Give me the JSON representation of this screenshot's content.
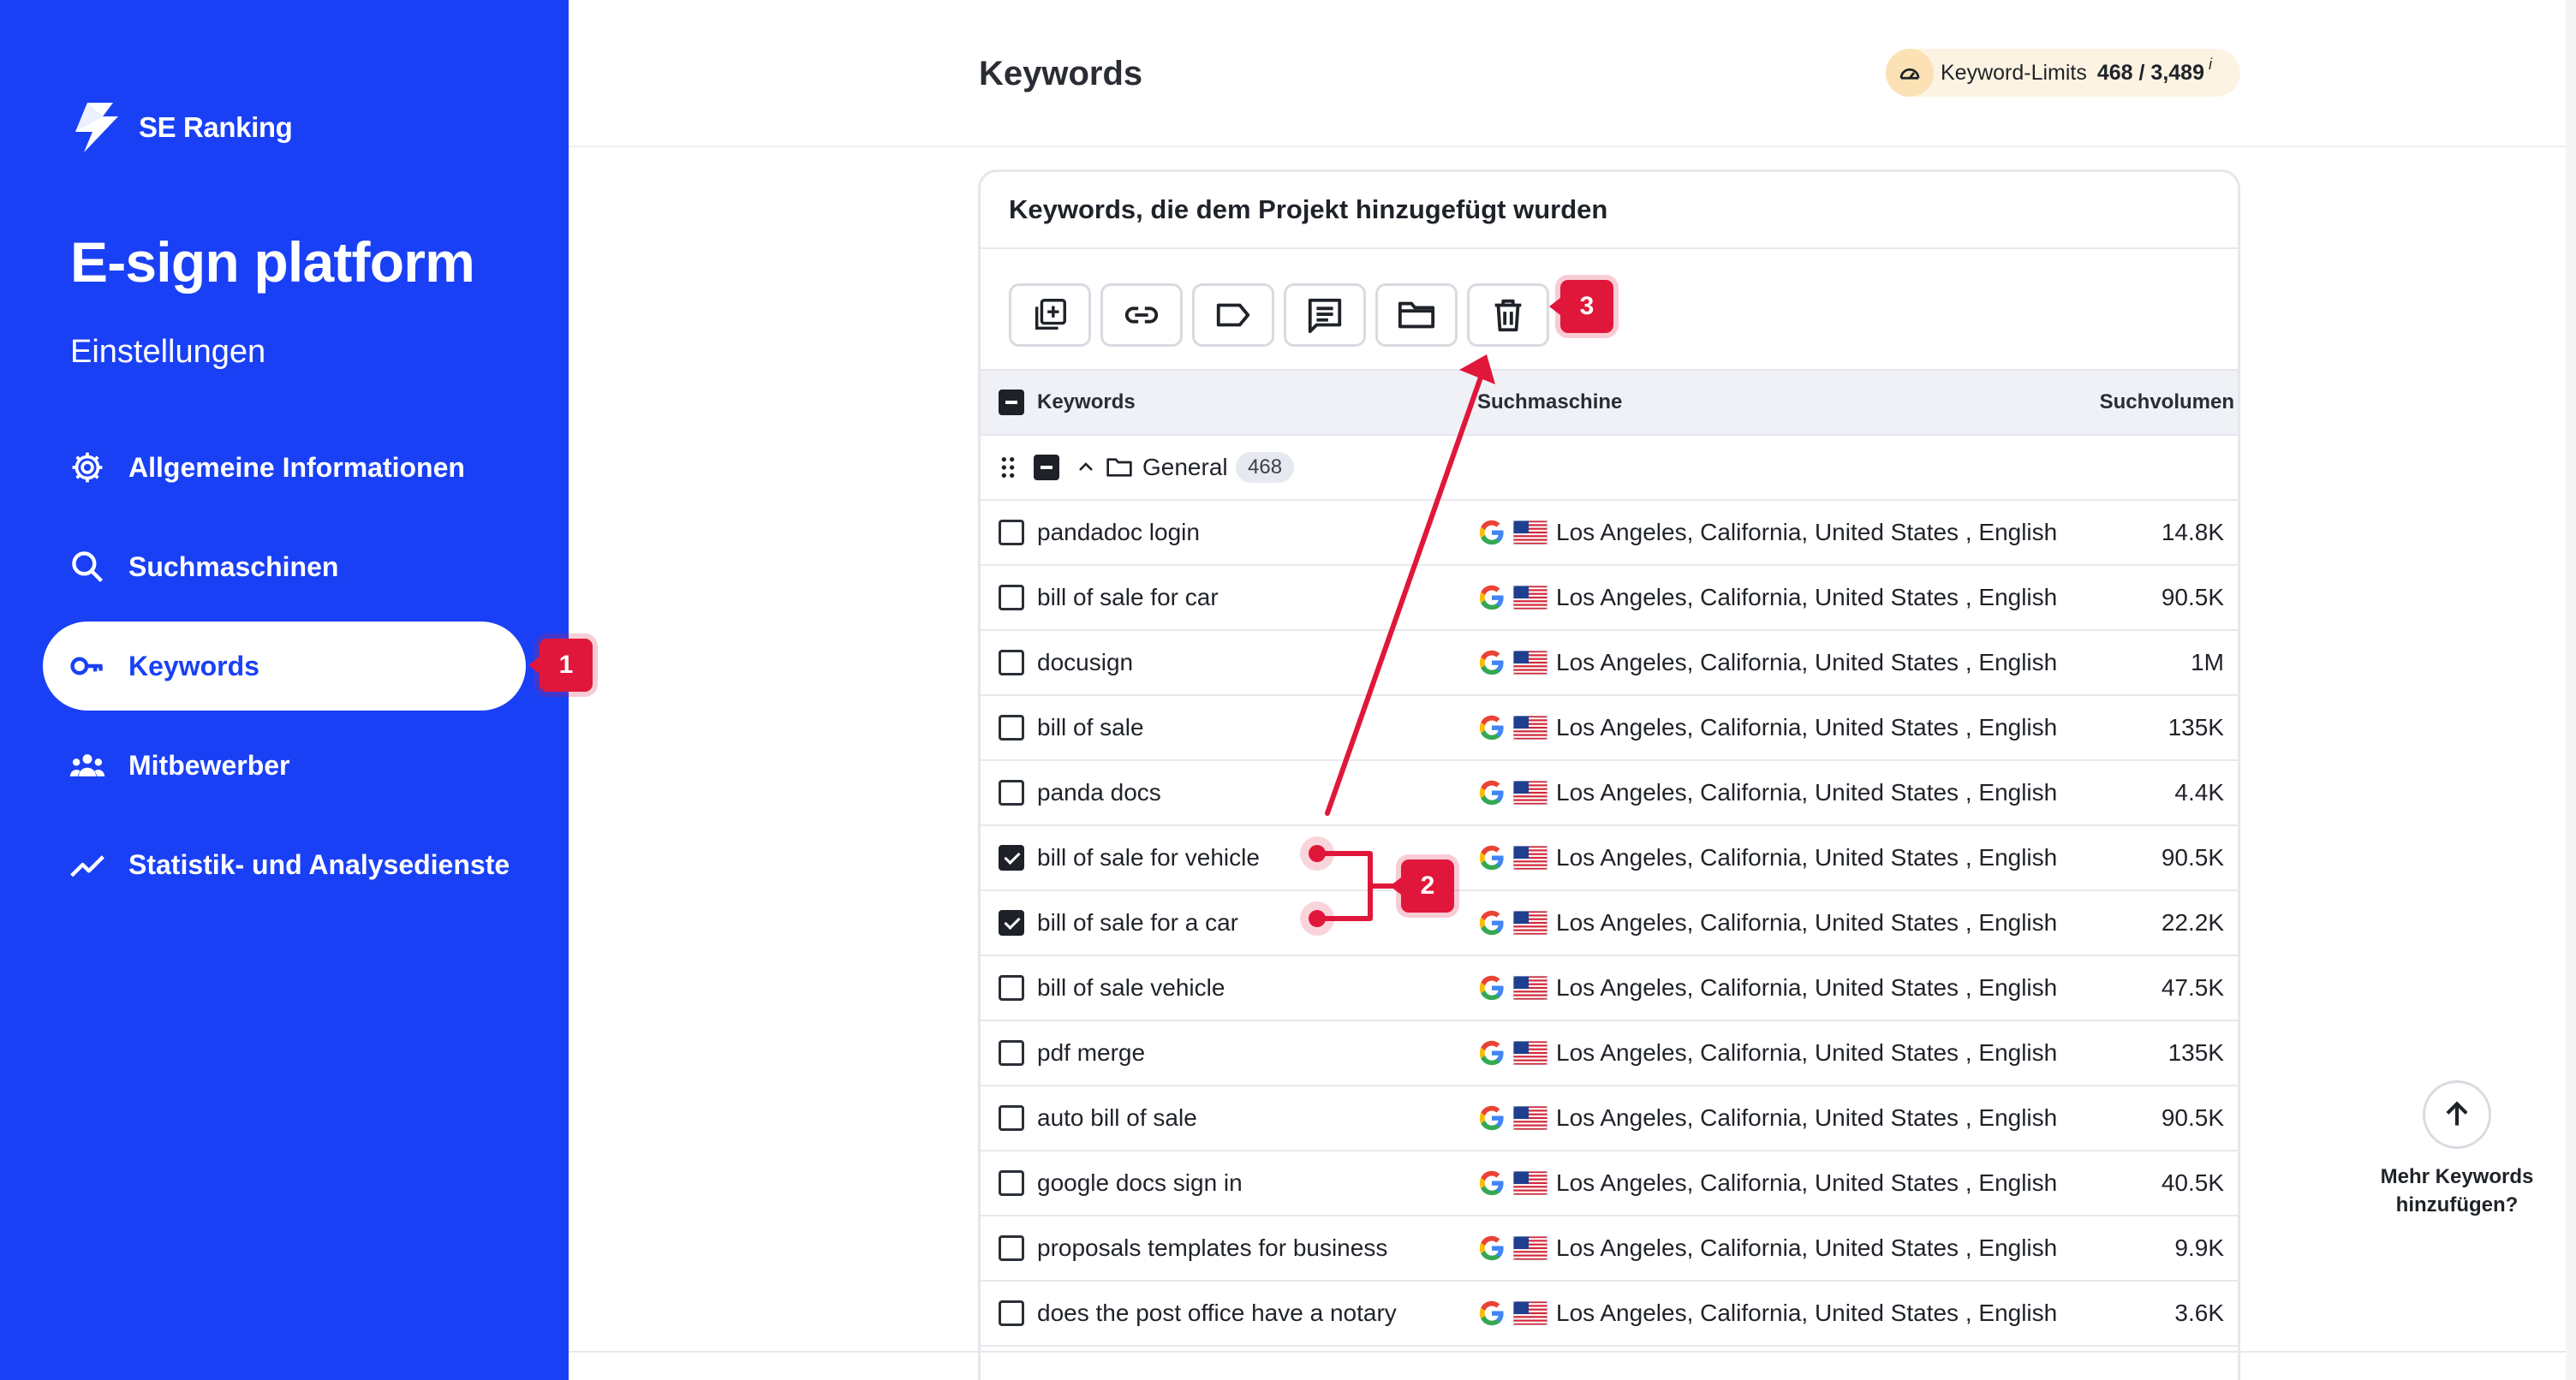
{
  "brand": {
    "name": "SE Ranking"
  },
  "project": {
    "title": "E-sign platform",
    "subtitle": "Einstellungen"
  },
  "nav": [
    {
      "label": "Allgemeine Informationen",
      "icon": "gear-icon"
    },
    {
      "label": "Suchmaschinen",
      "icon": "search-icon"
    },
    {
      "label": "Keywords",
      "icon": "key-icon",
      "active": true
    },
    {
      "label": "Mitbewerber",
      "icon": "users-icon"
    },
    {
      "label": "Statistik- und Analysedienste",
      "icon": "chart-line-icon"
    }
  ],
  "header": {
    "title": "Keywords",
    "limit_label": "Keyword-Limits",
    "limit_value": "468 / 3,489",
    "limit_info": "i"
  },
  "panel": {
    "title": "Keywords, die dem Projekt hinzugefügt wurden",
    "toolbar": [
      "add-keywords-icon",
      "link-icon",
      "tag-icon",
      "comment-icon",
      "folder-icon",
      "trash-icon"
    ]
  },
  "table": {
    "columns": {
      "keyword": "Keywords",
      "engine": "Suchmaschine",
      "volume": "Suchvolumen"
    },
    "group": {
      "name": "General",
      "count": "468"
    },
    "rows": [
      {
        "keyword": "pandadoc login",
        "location": "Los Angeles, California, United States , English",
        "volume": "14.8K",
        "checked": false
      },
      {
        "keyword": "bill of sale for car",
        "location": "Los Angeles, California, United States , English",
        "volume": "90.5K",
        "checked": false
      },
      {
        "keyword": "docusign",
        "location": "Los Angeles, California, United States , English",
        "volume": "1M",
        "checked": false
      },
      {
        "keyword": "bill of sale",
        "location": "Los Angeles, California, United States , English",
        "volume": "135K",
        "checked": false
      },
      {
        "keyword": "panda docs",
        "location": "Los Angeles, California, United States , English",
        "volume": "4.4K",
        "checked": false
      },
      {
        "keyword": "bill of sale for vehicle",
        "location": "Los Angeles, California, United States , English",
        "volume": "90.5K",
        "checked": true
      },
      {
        "keyword": "bill of sale for a car",
        "location": "Los Angeles, California, United States , English",
        "volume": "22.2K",
        "checked": true
      },
      {
        "keyword": "bill of sale vehicle",
        "location": "Los Angeles, California, United States , English",
        "volume": "47.5K",
        "checked": false
      },
      {
        "keyword": "pdf merge",
        "location": "Los Angeles, California, United States , English",
        "volume": "135K",
        "checked": false
      },
      {
        "keyword": "auto bill of sale",
        "location": "Los Angeles, California, United States , English",
        "volume": "90.5K",
        "checked": false
      },
      {
        "keyword": "google docs sign in",
        "location": "Los Angeles, California, United States , English",
        "volume": "40.5K",
        "checked": false
      },
      {
        "keyword": "proposals templates for business",
        "location": "Los Angeles, California, United States , English",
        "volume": "9.9K",
        "checked": false
      },
      {
        "keyword": "does the post office have a notary",
        "location": "Los Angeles, California, United States , English",
        "volume": "3.6K",
        "checked": false
      }
    ]
  },
  "annotations": [
    "1",
    "2",
    "3"
  ],
  "more_hint": "Mehr Keywords hinzufügen?",
  "colors": {
    "brand_blue": "#1a40f5",
    "annotation_red": "#e0173a",
    "limit_bg": "#fdf3e2"
  }
}
